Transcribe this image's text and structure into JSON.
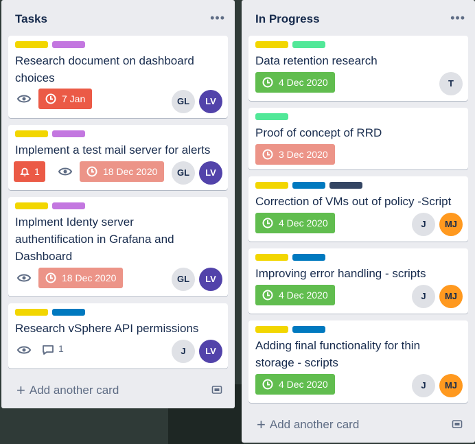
{
  "colors": {
    "label_yellow": "#f2d600",
    "label_purple": "#c377e0",
    "label_mint": "#51e898",
    "label_blue": "#0079bf",
    "label_navy": "#344563",
    "due_red": "#eb5a46",
    "due_pink": "#ec9488",
    "due_green": "#61bd4f",
    "avatar_purple": "#5243aa",
    "avatar_orange": "#ff991f"
  },
  "lists": [
    {
      "title": "Tasks",
      "menu_icon": "more-horizontal-icon",
      "add_card_label": "Add another card",
      "cards": [
        {
          "labels": [
            "yellow",
            "purple"
          ],
          "title_lines": [
            "Research document on dashboard",
            "choices"
          ],
          "watch_icon": "eye-icon",
          "due": "7 Jan",
          "members": [
            "GL",
            "LV"
          ]
        },
        {
          "labels": [
            "yellow",
            "purple"
          ],
          "title_lines": [
            "Implement a test mail server for alerts"
          ],
          "notifications": "1",
          "watch_icon": "eye-icon",
          "due": "18 Dec 2020",
          "members": [
            "GL",
            "LV"
          ]
        },
        {
          "labels": [
            "yellow",
            "purple"
          ],
          "title_lines": [
            "Implment Identy server",
            "authentification in Grafana and",
            "Dashboard"
          ],
          "watch_icon": "eye-icon",
          "due": "18 Dec 2020",
          "members": [
            "GL",
            "LV"
          ]
        },
        {
          "labels": [
            "yellow",
            "blue"
          ],
          "title_lines": [
            "Research vSphere API permissions"
          ],
          "watch_icon": "eye-icon",
          "comments": "1",
          "members": [
            "J",
            "LV"
          ]
        }
      ]
    },
    {
      "title": "In Progress",
      "menu_icon": "more-horizontal-icon",
      "add_card_label": "Add another card",
      "cards": [
        {
          "labels": [
            "yellow",
            "mint"
          ],
          "title_lines": [
            "Data retention research"
          ],
          "due": "4 Dec 2020",
          "members": [
            "T"
          ]
        },
        {
          "labels": [
            "mint"
          ],
          "title_lines": [
            "Proof of concept of RRD"
          ],
          "due": "3 Dec 2020"
        },
        {
          "labels": [
            "yellow",
            "blue",
            "navy"
          ],
          "title_lines": [
            "Correction of VMs out of policy -Script"
          ],
          "due": "4 Dec 2020",
          "members": [
            "J",
            "MJ"
          ]
        },
        {
          "labels": [
            "yellow",
            "blue"
          ],
          "title_lines": [
            "Improving error handling - scripts"
          ],
          "due": "4 Dec 2020",
          "members": [
            "J",
            "MJ"
          ]
        },
        {
          "labels": [
            "yellow",
            "blue"
          ],
          "title_lines": [
            "Adding final functionality for thin",
            "storage - scripts"
          ],
          "due": "4 Dec 2020",
          "members": [
            "J",
            "MJ"
          ]
        }
      ]
    }
  ]
}
